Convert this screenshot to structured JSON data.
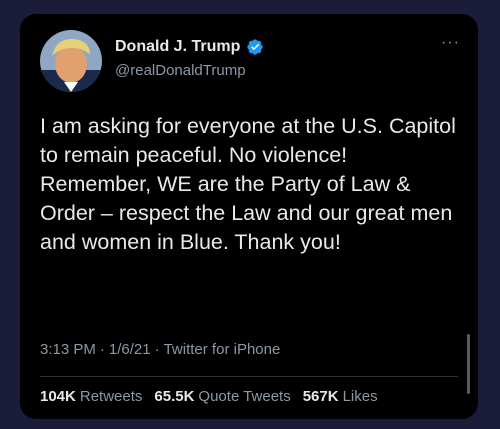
{
  "user": {
    "name": "Donald J. Trump",
    "handle": "@realDonaldTrump",
    "verified_icon": "verified-badge-icon",
    "accent": "#1d9bf0"
  },
  "more_icon": "more-options-icon",
  "more_label": "···",
  "tweet": {
    "text": "I am asking for everyone at the U.S. Capitol to remain peaceful. No violence! Remember, WE are the Party of Law & Order – respect the Law and our great men and women in Blue. Thank you!"
  },
  "meta": {
    "time": "3:13 PM",
    "sep1": "·",
    "date": "1/6/21",
    "sep2": "·",
    "source": "Twitter for iPhone"
  },
  "stats": {
    "retweets_count": "104K",
    "retweets_label": "Retweets",
    "quotes_count": "65.5K",
    "quotes_label": "Quote Tweets",
    "likes_count": "567K",
    "likes_label": "Likes"
  },
  "colors": {
    "background": "#1b1b3a",
    "card": "#000000",
    "text": "#e7e9ea",
    "secondary": "#8b98a5"
  }
}
